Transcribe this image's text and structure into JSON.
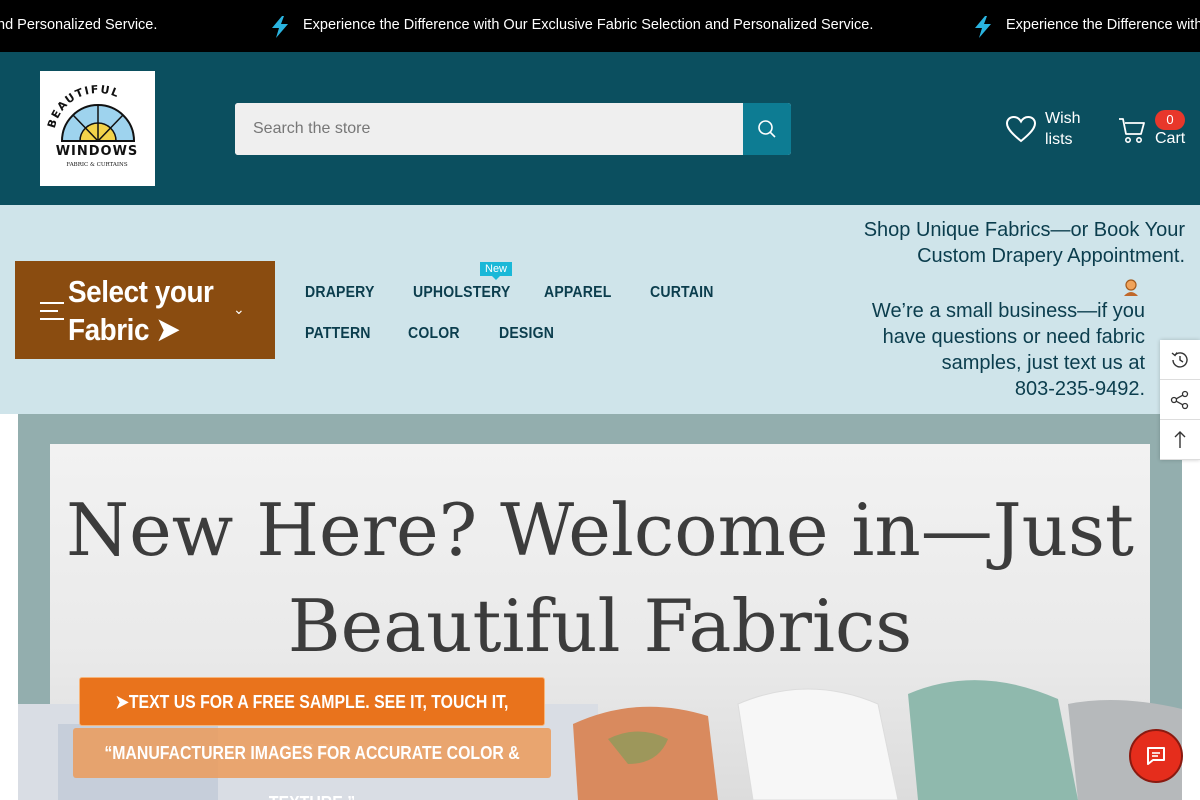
{
  "announcement": {
    "messages": [
      "nd Personalized Service.",
      "Experience the Difference with Our Exclusive Fabric Selection and Personalized Service.",
      "Experience the Difference with"
    ],
    "icon": "lightning-bolt-icon",
    "accent": "#2ab4e0"
  },
  "header": {
    "logo": {
      "line1": "BEAUTIFUL",
      "line2": "WINDOWS",
      "line3": "FABRIC & CURTAINS"
    },
    "search": {
      "placeholder": "Search the store",
      "value": ""
    },
    "wishlist_label": "Wish lists",
    "cart_label": "Cart",
    "cart_count": "0",
    "colors": {
      "header_bg": "#0b4f5f",
      "search_button": "#0d7c93",
      "badge": "#e8372b"
    }
  },
  "nav": {
    "select_fabric": "Select your Fabric ➤",
    "menu": [
      {
        "label": "DRAPERY"
      },
      {
        "label": "UPHOLSTERY",
        "badge": "New"
      },
      {
        "label": "APPAREL"
      },
      {
        "label": "CURTAIN"
      },
      {
        "label": "PATTERN"
      },
      {
        "label": "COLOR"
      },
      {
        "label": "DESIGN"
      }
    ],
    "promo_line1": "Shop Unique Fabrics—or Book Your",
    "promo_line2": "Custom Drapery Appointment.",
    "contact_line1": "We’re a small business—if you",
    "contact_line2": "have questions or need fabric",
    "contact_line3": "samples, just text us at",
    "contact_line4": "803-235-9492."
  },
  "tools": [
    "recently-viewed-icon",
    "share-icon",
    "back-to-top-icon"
  ],
  "hero": {
    "title_line1": "New Here? Welcome in—Just",
    "title_line2": "Beautiful Fabrics",
    "cta_primary": "➤TEXT US FOR A FREE SAMPLE. SEE IT, TOUCH IT, LOVE IT. ➤",
    "cta_secondary": "“MANUFACTURER IMAGES FOR ACCURATE COLOR & TEXTURE.”",
    "colors": {
      "cta": "#e9731c",
      "chat": "#e52d1c"
    }
  }
}
